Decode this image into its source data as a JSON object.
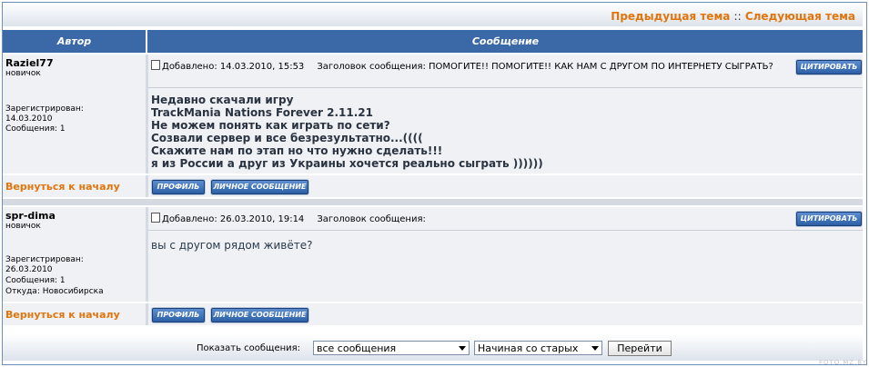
{
  "nav": {
    "prev": "Предыдущая тема",
    "sep": "::",
    "next": "Следующая тема"
  },
  "table": {
    "col_author": "Автор",
    "col_message": "Сообщение"
  },
  "posts": [
    {
      "username": "Raziel77",
      "rank": "новичок",
      "registered_label": "Зарегистрирован:",
      "registered_date": "14.03.2010",
      "messages": "Сообщения: 1",
      "location": "",
      "added": "Добавлено: 14.03.2010, 15:53",
      "subject": "Заголовок сообщения: ПОМОГИТЕ!! ПОМОГИТЕ!! КАК НАМ С ДРУГОМ ПО ИНТЕРНЕТУ СЫГРАТЬ?",
      "lines": [
        "Недавно скачали игру",
        "TrackMania Nations Forever 2.11.21",
        "Не можем понять как играть по сети?",
        "Созвали сервер и все безрезультатно...((((",
        "Скажите нам по этап но что нужно сделать!!!",
        "я из России а друг из Украины хочется реально сыграть ))))))"
      ]
    },
    {
      "username": "spr-dima",
      "rank": "новичок",
      "registered_label": "Зарегистрирован:",
      "registered_date": "26.03.2010",
      "messages": "Сообщения: 1",
      "location": "Откуда: Новосибирска",
      "added": "Добавлено: 26.03.2010, 19:14",
      "subject": "Заголовок сообщения:",
      "lines": [
        "вы с другом рядом живёте?"
      ]
    }
  ],
  "buttons": {
    "quote": "ЦИТИРОВАТЬ",
    "profile": "ПРОФИЛЬ",
    "pm": "ЛИЧНОЕ СООБЩЕНИЕ"
  },
  "back_to_top": "Вернуться к началу",
  "footer": {
    "show_label": "Показать сообщения:",
    "filter_value": "все сообщения",
    "order_value": "Начиная со старых",
    "go_label": "Перейти"
  },
  "watermark": "FOTO.MZ.BY"
}
